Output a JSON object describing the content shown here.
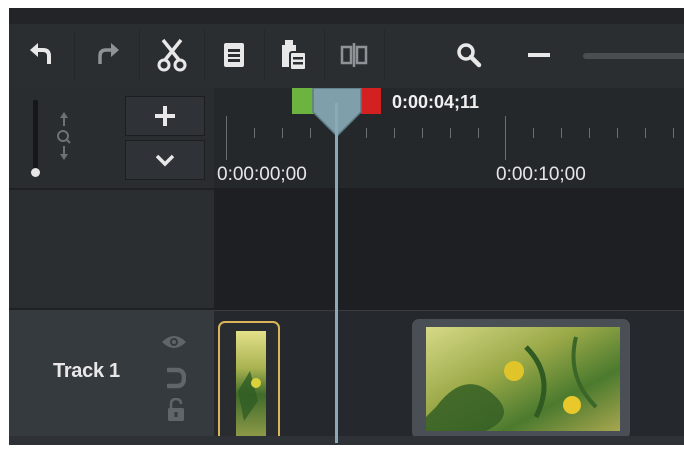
{
  "toolbar": {
    "buttons": [
      {
        "name": "undo-button",
        "icon": "undo-icon"
      },
      {
        "name": "redo-button",
        "icon": "redo-icon"
      },
      {
        "name": "cut-button",
        "icon": "scissors-icon"
      },
      {
        "name": "copy-button",
        "icon": "copy-icon"
      },
      {
        "name": "paste-button",
        "icon": "paste-icon"
      },
      {
        "name": "split-button",
        "icon": "split-icon"
      },
      {
        "name": "zoom-button",
        "icon": "magnifier-icon"
      },
      {
        "name": "zoom-out-button",
        "icon": "minus-icon"
      }
    ]
  },
  "controls": {
    "add_track_icon": "plus-icon",
    "collapse_icon": "chevron-down-icon"
  },
  "playhead": {
    "time": "0:00:04;11"
  },
  "ruler": {
    "labels": [
      "0:00:00;00",
      "0:00:10;00"
    ]
  },
  "track": {
    "name": "Track 1",
    "icons": [
      "eye-icon",
      "magnet-icon",
      "lock-icon"
    ]
  },
  "colors": {
    "in_marker": "#6cb33f",
    "out_marker": "#d32020",
    "playhead": "#8aaab8",
    "selected_clip_border": "#d9b45a"
  }
}
